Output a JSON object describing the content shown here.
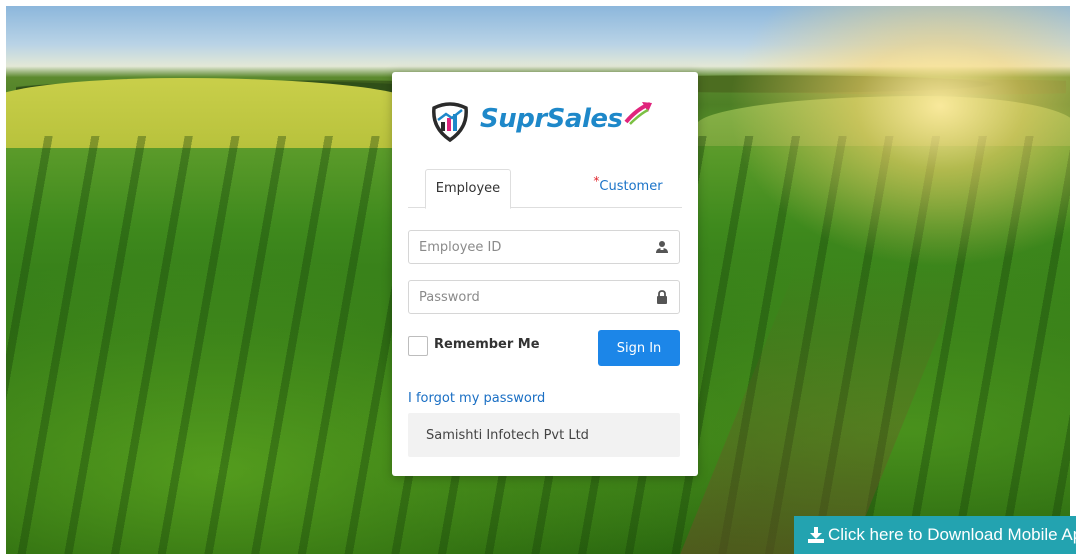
{
  "brand": {
    "name_part1": "Supr",
    "name_part2": "Sales",
    "primary_color": "#1e88c9",
    "accent_color": "#e0247c"
  },
  "login": {
    "tabs": [
      {
        "label": "Employee",
        "active": true
      },
      {
        "label": "Customer",
        "active": false,
        "required_marker": "*"
      }
    ],
    "employee_id_placeholder": "Employee ID",
    "employee_id_icon": "user-icon",
    "password_placeholder": "Password",
    "password_icon": "lock-icon",
    "remember_label": "Remember Me",
    "remember_checked": false,
    "sign_in_label": "Sign In",
    "forgot_link": "I forgot my password",
    "company": "Samishti Infotech Pvt Ltd"
  },
  "download": {
    "label": "Click here to Download Mobile App",
    "icon": "download-icon",
    "color": "#23a3b0"
  }
}
